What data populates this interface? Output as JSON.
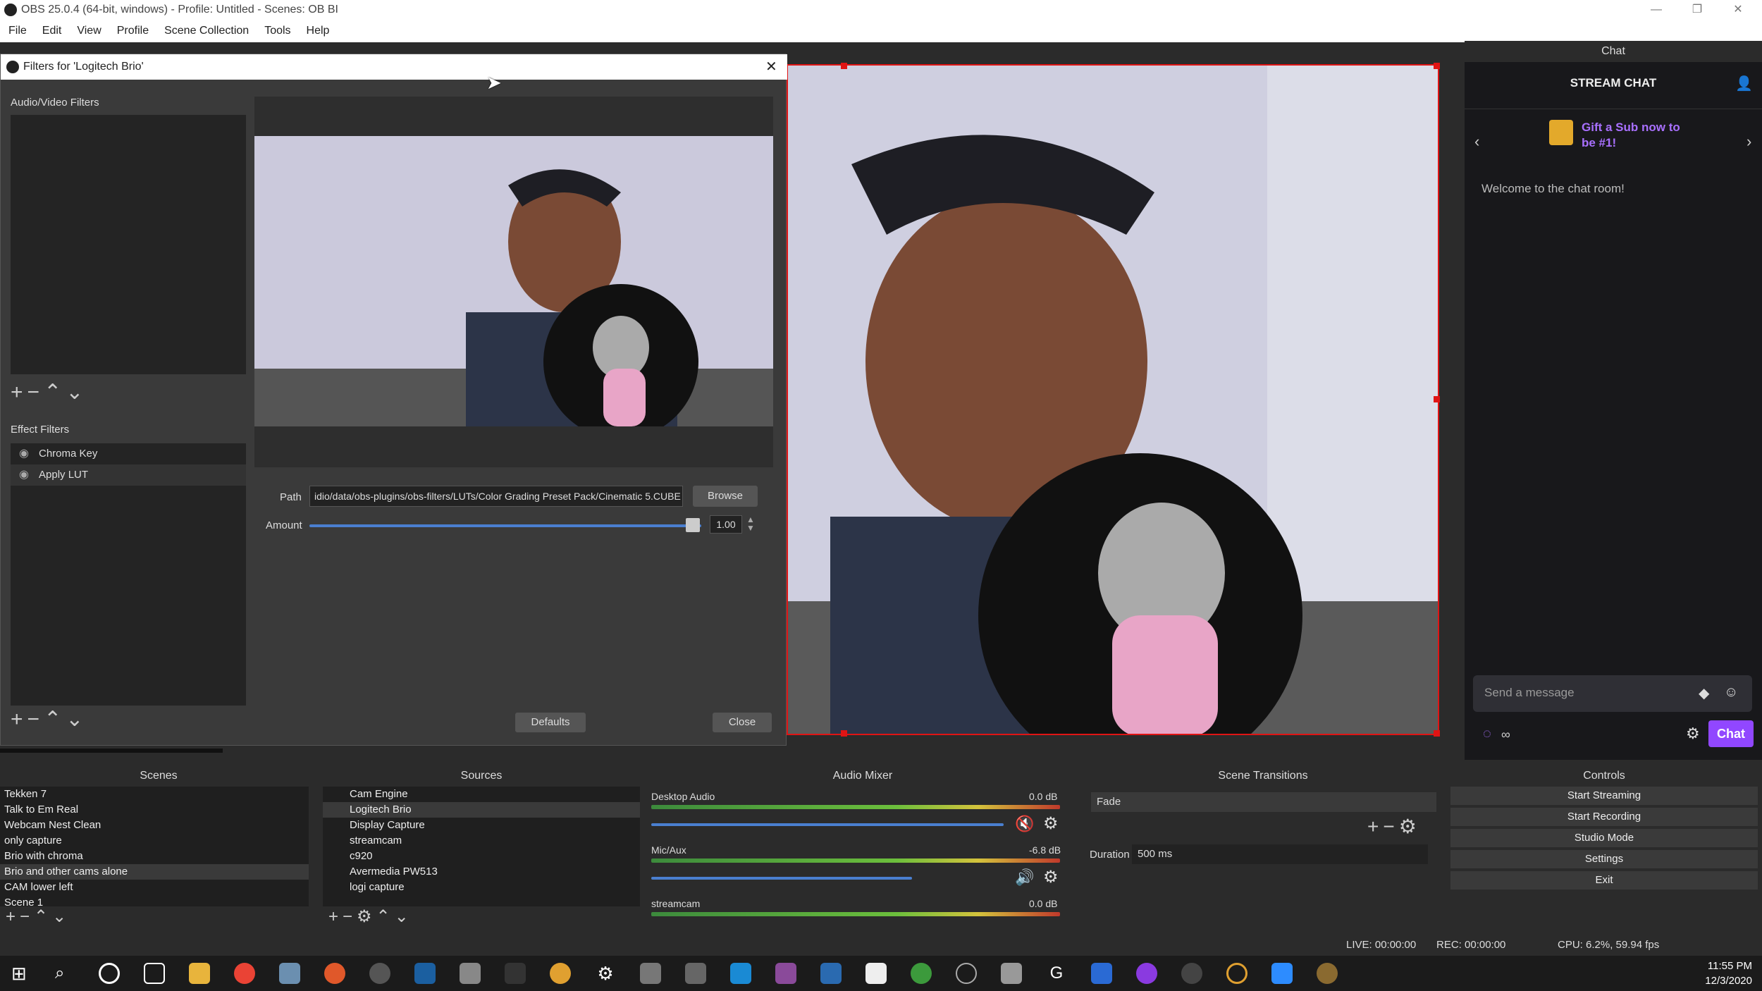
{
  "window": {
    "title": "OBS 25.0.4 (64-bit, windows) - Profile: Untitled - Scenes: OB BI"
  },
  "menu": [
    "File",
    "Edit",
    "View",
    "Profile",
    "Scene Collection",
    "Tools",
    "Help"
  ],
  "filters_dialog": {
    "title": "Filters for 'Logitech Brio'",
    "audio_video_label": "Audio/Video Filters",
    "effect_label": "Effect Filters",
    "effect_filters": [
      "Chroma Key",
      "Apply LUT"
    ],
    "path_label": "Path",
    "path_value": "idio/data/obs-plugins/obs-filters/LUTs/Color Grading Preset Pack/Cinematic 5.CUBE",
    "browse": "Browse",
    "amount_label": "Amount",
    "amount_value": "1.00",
    "defaults": "Defaults",
    "close": "Close"
  },
  "chat": {
    "dock_title": "Chat",
    "header": "STREAM CHAT",
    "promo": "Gift a Sub now to be #1!",
    "welcome": "Welcome to the chat room!",
    "placeholder": "Send a message",
    "chat_button": "Chat",
    "points": "∞"
  },
  "scenes": {
    "title": "Scenes",
    "items": [
      "Tekken 7",
      "Talk to Em Real",
      "Webcam Nest Clean",
      "only capture",
      "Brio with chroma",
      "Brio and other cams alone",
      "CAM lower left",
      "Scene 1"
    ]
  },
  "sources": {
    "title": "Sources",
    "items": [
      "Cam Engine",
      "Logitech Brio",
      "Display Capture",
      "streamcam",
      "c920",
      "Avermedia PW513",
      "logi capture"
    ]
  },
  "mixer": {
    "title": "Audio Mixer",
    "channels": [
      {
        "name": "Desktop Audio",
        "db": "0.0 dB",
        "level": 0.9
      },
      {
        "name": "Mic/Aux",
        "db": "-6.8 dB",
        "level": 0.7
      },
      {
        "name": "streamcam",
        "db": "0.0 dB",
        "level": 0.9
      }
    ]
  },
  "transitions": {
    "title": "Scene Transitions",
    "selected": "Fade",
    "duration_label": "Duration",
    "duration": "500 ms"
  },
  "controls": {
    "title": "Controls",
    "buttons": [
      "Start Streaming",
      "Start Recording",
      "Studio Mode",
      "Settings",
      "Exit"
    ]
  },
  "status": {
    "live": "LIVE: 00:00:00",
    "rec": "REC: 00:00:00",
    "cpu": "CPU: 6.2%, 59.94 fps"
  },
  "clock": {
    "time": "11:55 PM",
    "date": "12/3/2020"
  }
}
